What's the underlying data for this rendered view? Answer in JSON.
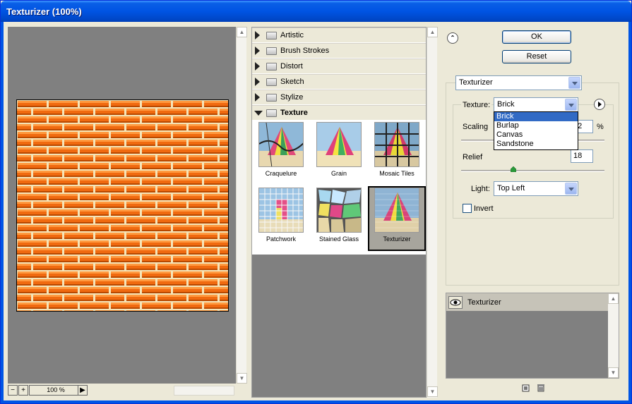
{
  "window": {
    "title": "Texturizer (100%)"
  },
  "preview": {
    "zoom_out_label": "−",
    "zoom_in_label": "+",
    "zoom_value": "100 %"
  },
  "browser": {
    "categories": [
      {
        "label": "Artistic",
        "open": false
      },
      {
        "label": "Brush Strokes",
        "open": false
      },
      {
        "label": "Distort",
        "open": false
      },
      {
        "label": "Sketch",
        "open": false
      },
      {
        "label": "Stylize",
        "open": false
      },
      {
        "label": "Texture",
        "open": true
      }
    ],
    "filters": [
      {
        "label": "Craquelure",
        "selected": false
      },
      {
        "label": "Grain",
        "selected": false
      },
      {
        "label": "Mosaic Tiles",
        "selected": false
      },
      {
        "label": "Patchwork",
        "selected": false
      },
      {
        "label": "Stained Glass",
        "selected": false
      },
      {
        "label": "Texturizer",
        "selected": true
      }
    ]
  },
  "buttons": {
    "ok": "OK",
    "reset": "Reset"
  },
  "filter_select": {
    "value": "Texturizer"
  },
  "settings": {
    "texture_label": "Texture:",
    "texture_value": "Brick",
    "texture_options": [
      "Brick",
      "Burlap",
      "Canvas",
      "Sandstone"
    ],
    "scaling_label": "Scaling",
    "scaling_value": "42",
    "scaling_unit": "%",
    "relief_label": "Relief",
    "relief_value": "18",
    "light_label": "Light:",
    "light_value": "Top Left",
    "invert_label": "Invert",
    "invert_checked": false
  },
  "layers": {
    "items": [
      {
        "label": "Texturizer"
      }
    ]
  },
  "colors": {
    "accent": "#0054e3",
    "brick": "#f06a10",
    "mortar": "#f4e4b8",
    "selection": "#316ac5"
  }
}
